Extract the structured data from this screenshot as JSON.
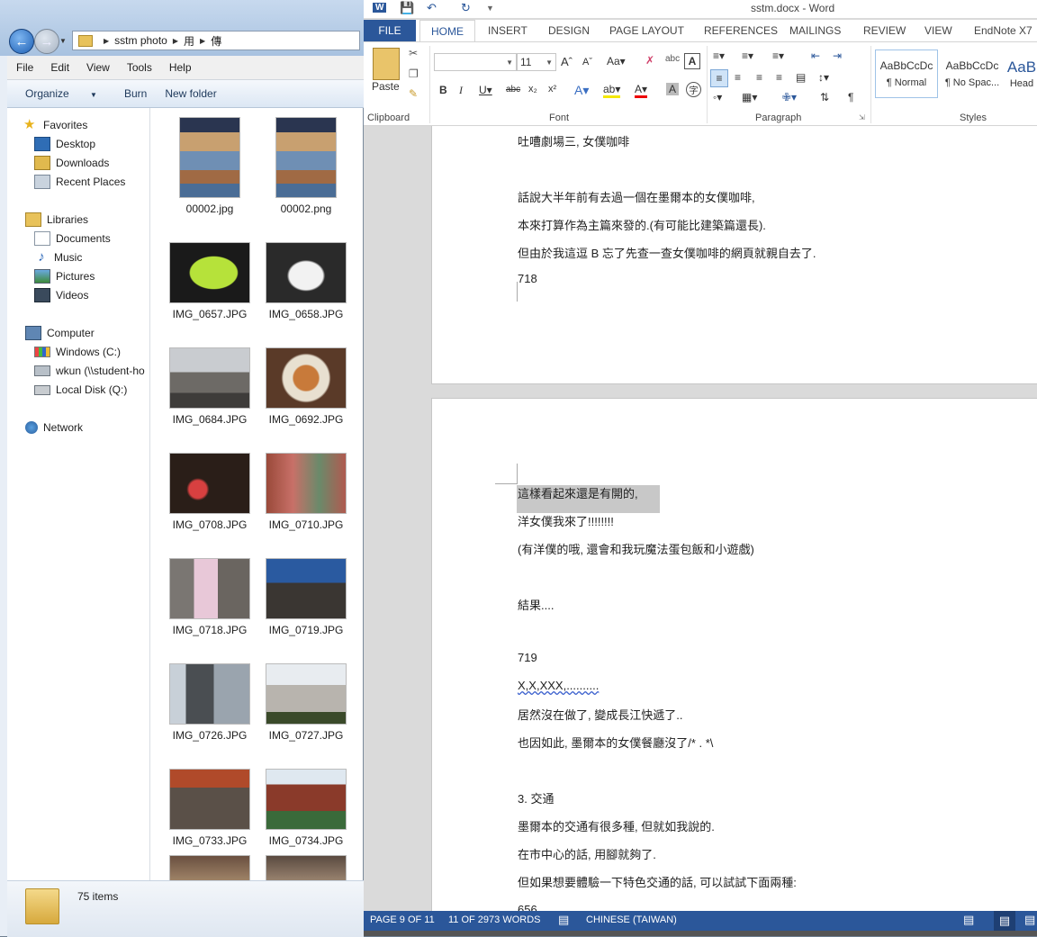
{
  "explorer": {
    "address": {
      "segments": [
        "sstm photo",
        "用",
        "傳"
      ]
    },
    "menu": [
      "File",
      "Edit",
      "View",
      "Tools",
      "Help"
    ],
    "toolbar": {
      "organize": "Organize",
      "burn": "Burn",
      "new_folder": "New folder"
    },
    "nav": {
      "favorites": "Favorites",
      "desktop": "Desktop",
      "downloads": "Downloads",
      "recent_places": "Recent Places",
      "libraries": "Libraries",
      "documents": "Documents",
      "music": "Music",
      "pictures": "Pictures",
      "videos": "Videos",
      "computer": "Computer",
      "windows_c": "Windows (C:)",
      "wkun": "wkun (\\\\student-ho",
      "local_disk": "Local Disk (Q:)",
      "network": "Network"
    },
    "files": [
      "00002.jpg",
      "00002.png",
      "IMG_0657.JPG",
      "IMG_0658.JPG",
      "IMG_0684.JPG",
      "IMG_0692.JPG",
      "IMG_0708.JPG",
      "IMG_0710.JPG",
      "IMG_0718.JPG",
      "IMG_0719.JPG",
      "IMG_0726.JPG",
      "IMG_0727.JPG",
      "IMG_0733.JPG",
      "IMG_0734.JPG"
    ],
    "status": {
      "item_count": "75 items"
    }
  },
  "word": {
    "title": "sstm.docx - Word",
    "tabs": {
      "file": "FILE",
      "home": "HOME",
      "insert": "INSERT",
      "design": "DESIGN",
      "page_layout": "PAGE LAYOUT",
      "references": "REFERENCES",
      "mailings": "MAILINGS",
      "review": "REVIEW",
      "view": "VIEW",
      "endnote": "EndNote X7"
    },
    "ribbon": {
      "paste": "Paste",
      "font_size": "11",
      "clipboard_label": "Clipboard",
      "font_label": "Font",
      "paragraph_label": "Paragraph",
      "styles_label": "Styles",
      "style_normal_preview": "AaBbCcDc",
      "style_normal_name": "¶ Normal",
      "style_nospacing_preview": "AaBbCcDc",
      "style_nospacing_name": "¶ No Spac...",
      "style_heading_preview": "AaB",
      "style_heading_name": "Head"
    },
    "page1_lines": [
      "吐嘈劇場三, 女僕咖啡",
      "話說大半年前有去過一個在墨爾本的女僕咖啡,",
      "本來打算作為主篇來發的.(有可能比建築篇還長).",
      "但由於我這逗 B 忘了先查一查女僕咖啡的網頁就親自去了.",
      "718"
    ],
    "page2_lines": [
      "這樣看起來還是有開的,",
      "洋女僕我來了!!!!!!!!",
      "(有洋僕的哦, 還會和我玩魔法蛋包飯和小遊戲)",
      "結果....",
      "719",
      "X,X,XXX,..........",
      "居然沒在做了, 變成長江快遞了..",
      "也因如此, 墨爾本的女僕餐廳沒了/* . *\\",
      "3. 交通",
      "墨爾本的交通有很多種, 但就如我說的.",
      "在市中心的話, 用腳就夠了.",
      "但如果想要體驗一下特色交通的話, 可以試試下面兩種:",
      "656"
    ],
    "status": {
      "page": "PAGE 9 OF 11",
      "words": "11 OF 2973 WORDS",
      "language": "CHINESE (TAIWAN)"
    }
  }
}
